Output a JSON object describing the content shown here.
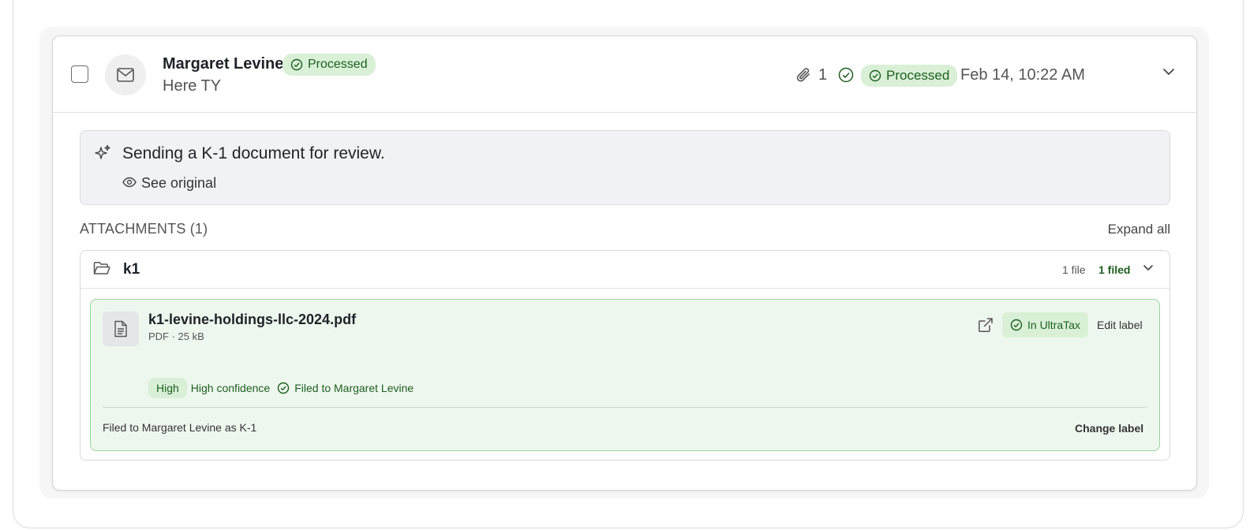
{
  "email": {
    "sender": "Margaret Levine",
    "status": "Processed",
    "subject": "Here TY",
    "attachment_count": "1",
    "meta_status": "Processed",
    "date": "Feb 14, 10:22 AM"
  },
  "summary": {
    "text": "Sending a K-1 document for review.",
    "see_original": "See original"
  },
  "attachments": {
    "heading": "ATTACHMENTS (1)",
    "expand_all": "Expand all",
    "groups": [
      {
        "name": "k1",
        "file_count": "1 file",
        "filed_count": "1 filed",
        "files": [
          {
            "name": "k1-levine-holdings-llc-2024.pdf",
            "meta": "PDF · 25 kB",
            "status": "In UltraTax",
            "edit_label": "Edit label",
            "confidence_badge": "High",
            "confidence_text": "High confidence",
            "filed_to": "Filed to Margaret Levine",
            "filed_as": "Filed to Margaret Levine as K-1",
            "change_label": "Change label"
          }
        ]
      }
    ]
  },
  "colors": {
    "accent_green": "#1d5e20",
    "pill_green_bg": "#d9f0d7",
    "file_card_bg": "#eef7ee",
    "file_card_border": "#9bd39c"
  }
}
